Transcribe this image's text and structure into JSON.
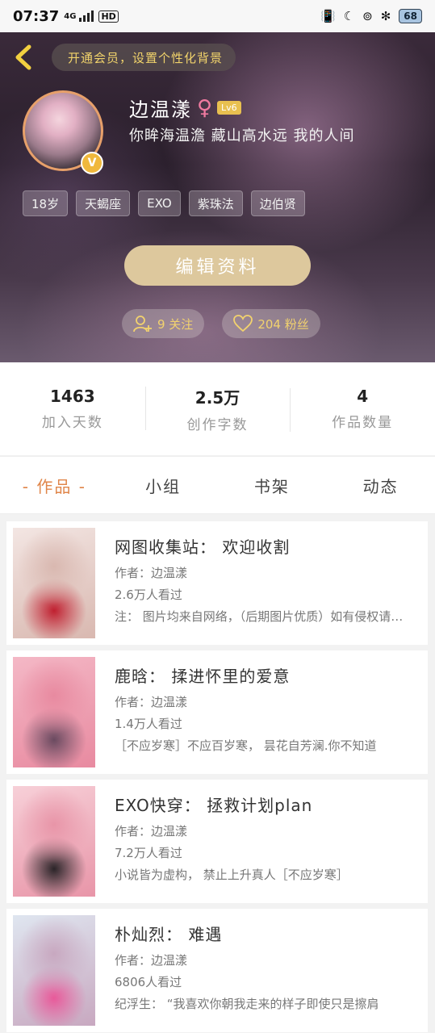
{
  "status_bar": {
    "time": "07:37",
    "network": "4G",
    "hd": "HD",
    "battery": "68"
  },
  "header": {
    "vip_banner": "开通会员，设置个性化背景",
    "name": "边温漾",
    "level": "Lv6",
    "verified_badge": "V",
    "bio": "你眸海温澹 藏山高水远 我的人间",
    "tags": [
      "18岁",
      "天蝎座",
      "EXO",
      "紫珠法",
      "边伯贤"
    ],
    "edit_button": "编辑资料",
    "following": "9 关注",
    "followers": "204 粉丝"
  },
  "stats": [
    {
      "value": "1463",
      "label": "加入天数"
    },
    {
      "value": "2.5万",
      "label": "创作字数"
    },
    {
      "value": "4",
      "label": "作品数量"
    }
  ],
  "tabs": [
    {
      "label": "- 作品 -",
      "active": true
    },
    {
      "label": "小组",
      "active": false
    },
    {
      "label": "书架",
      "active": false
    },
    {
      "label": "动态",
      "active": false
    }
  ],
  "works": [
    {
      "title": "网图收集站： 欢迎收割",
      "author": "作者：边温漾",
      "views": "2.6万人看过",
      "desc": "注： 图片均来自网络，（后期图片优质）如有侵权请联系删除",
      "cover_colors": [
        "#f3e6e3",
        "#d9b8b0",
        "#c02030"
      ]
    },
    {
      "title": "鹿晗： 揉进怀里的爱意",
      "author": "作者：边温漾",
      "views": "1.4万人看过",
      "desc": "［不应岁寒］不应百岁寒， 昙花自芳澜.你不知道",
      "cover_colors": [
        "#f4b8c6",
        "#e88aa0",
        "#6a4a60"
      ]
    },
    {
      "title": "EXO快穿： 拯救计划plan",
      "author": "作者：边温漾",
      "views": "7.2万人看过",
      "desc": "小说皆为虚构， 禁止上升真人［不应岁寒］",
      "cover_colors": [
        "#f7d0d8",
        "#e895a8",
        "#2a2428"
      ]
    },
    {
      "title": "朴灿烈： 难遇",
      "author": "作者：边温漾",
      "views": "6806人看过",
      "desc": "纪浮生： “我喜欢你朝我走来的样子即使只是擦肩",
      "cover_colors": [
        "#dfe6f0",
        "#c8a8c0",
        "#e85a9a"
      ]
    }
  ]
}
